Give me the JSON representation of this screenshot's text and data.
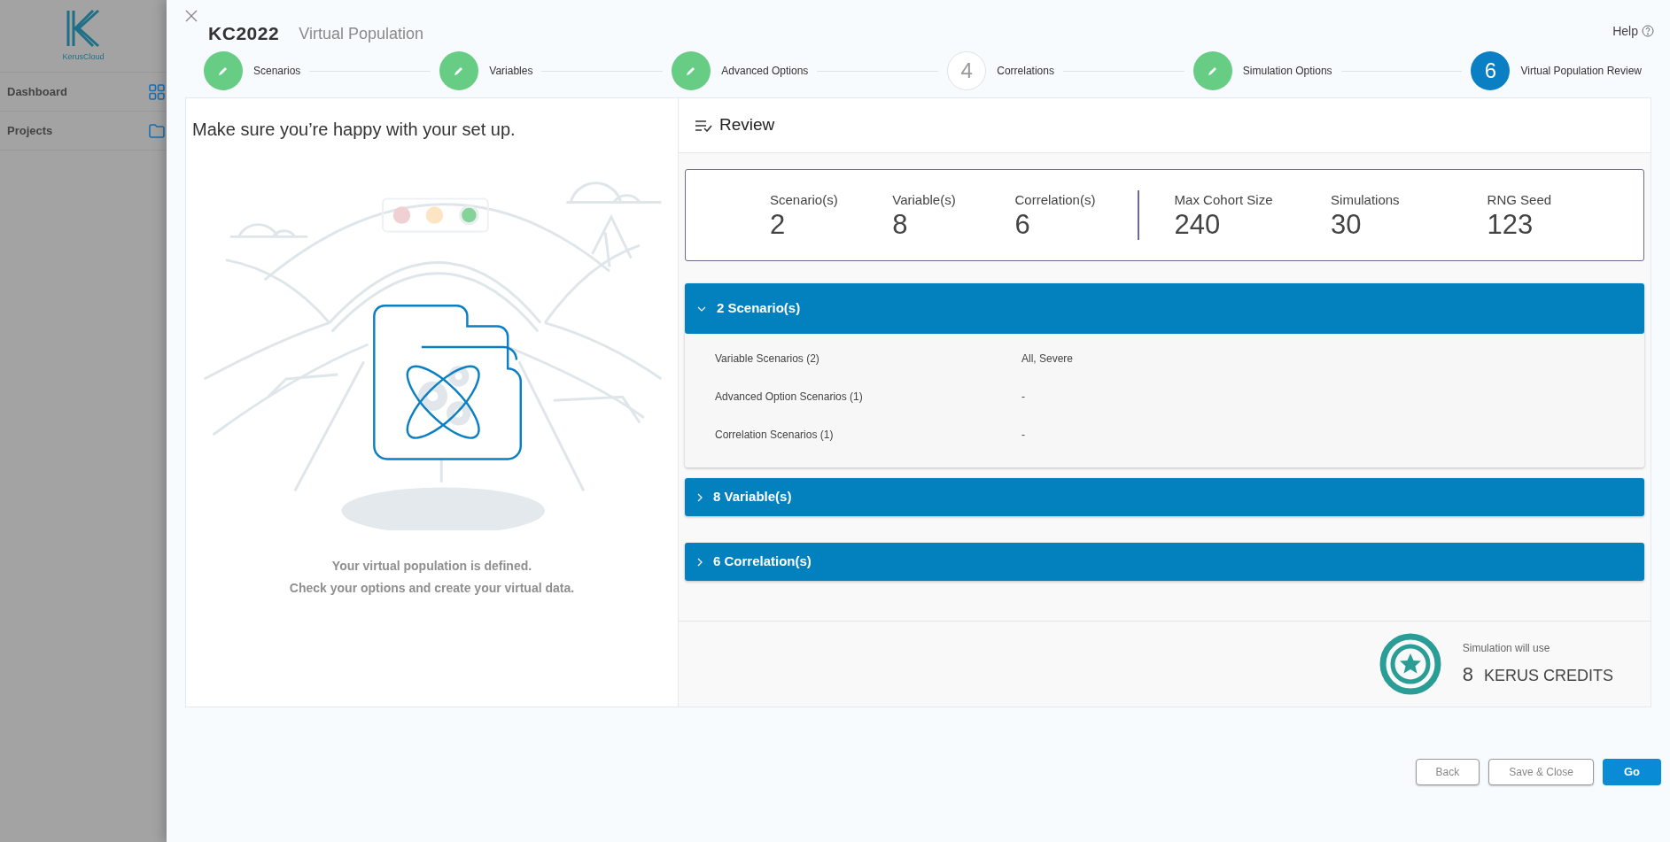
{
  "app": {
    "logo_text": "KerusCloud",
    "nav": [
      {
        "label": "Dashboard",
        "kind": "grid"
      },
      {
        "label": "Projects",
        "kind": "folder"
      }
    ]
  },
  "modal": {
    "project": "KC2022",
    "title": "Virtual Population",
    "help": "Help"
  },
  "steps": [
    {
      "label": "Scenarios",
      "kind": "done"
    },
    {
      "label": "Variables",
      "kind": "done"
    },
    {
      "label": "Advanced Options",
      "kind": "done"
    },
    {
      "label": "Correlations",
      "kind": "todo",
      "number": "4"
    },
    {
      "label": "Simulation Options",
      "kind": "done"
    },
    {
      "label": "Virtual Population Review",
      "kind": "current",
      "number": "6"
    }
  ],
  "intro": "Make sure you’re happy with your set up.",
  "message": [
    "Your virtual population is defined.",
    "Check your options and create your virtual data."
  ],
  "review": {
    "title": "Review",
    "stat_groups": [
      {
        "items": [
          {
            "label": "Scenario(s)",
            "value": "2"
          },
          {
            "label": "Variable(s)",
            "value": "8"
          },
          {
            "label": "Correlation(s)",
            "value": "6"
          }
        ]
      },
      {
        "items": [
          {
            "label": "Max Cohort Size",
            "value": "240"
          },
          {
            "label": "Simulations",
            "value": "30"
          },
          {
            "label": "RNG Seed",
            "value": "123"
          }
        ]
      }
    ],
    "sections": [
      {
        "title": "2 Scenario(s)",
        "expanded": true,
        "rows": [
          {
            "label": "Variable Scenarios (2)",
            "value": "All, Severe"
          },
          {
            "label": "Advanced Option Scenarios (1)",
            "value": "-"
          },
          {
            "label": "Correlation Scenarios (1)",
            "value": "-"
          }
        ]
      },
      {
        "title": "8 Variable(s)",
        "expanded": false
      },
      {
        "title": "6 Correlation(s)",
        "expanded": false
      }
    ],
    "credits": {
      "caption": "Simulation will use",
      "amount": "8",
      "unit": "KERUS CREDITS"
    }
  },
  "buttons": [
    {
      "label": "Back",
      "kind": "secondary"
    },
    {
      "label": "Save & Close",
      "kind": "secondary"
    },
    {
      "label": "Go",
      "kind": "primary"
    }
  ]
}
